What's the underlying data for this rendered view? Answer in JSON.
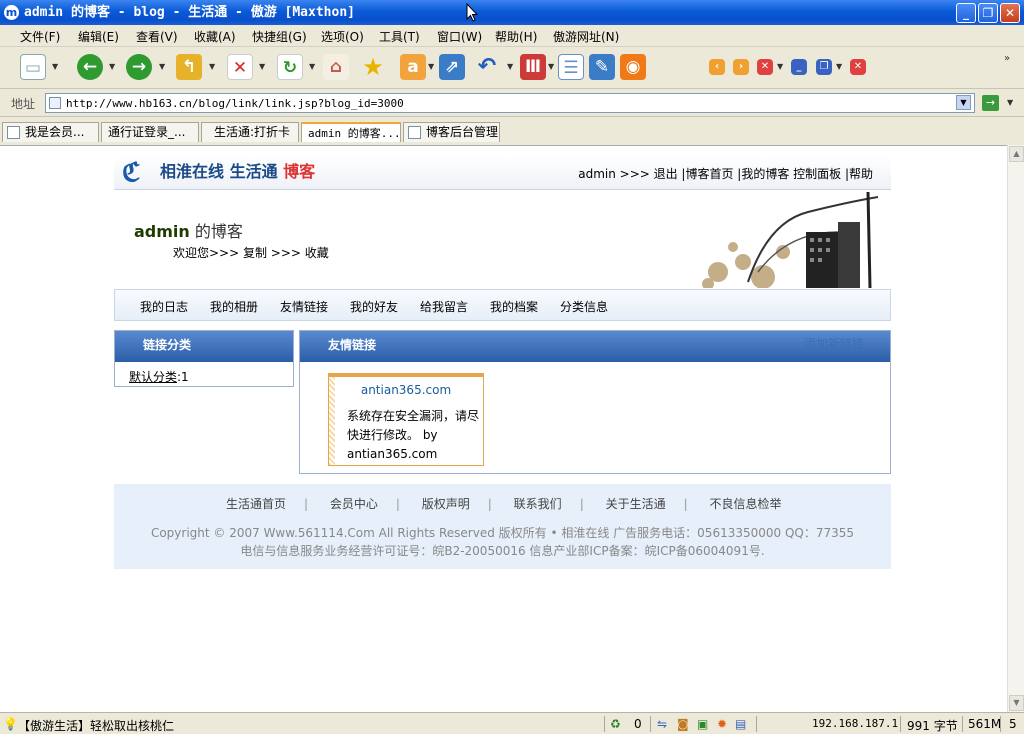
{
  "window": {
    "title": "admin 的博客 - blog - 生活通 - 傲游 [Maxthon]",
    "minimize": "_",
    "restore": "❐",
    "close": "✕"
  },
  "menu": [
    "文件(F)",
    "编辑(E)",
    "查看(V)",
    "收藏(A)",
    "快捷组(G)",
    "选项(O)",
    "工具(T)",
    "窗口(W)",
    "帮助(H)",
    "傲游网址(N)"
  ],
  "address": {
    "label": "地址",
    "url": "http://www.hb163.cn/blog/link/link.jsp?blog_id=3000"
  },
  "tabs": [
    "我是会员...",
    "通行证登录_...",
    "生活通:打折卡",
    "admin 的博客...",
    "博客后台管理"
  ],
  "page": {
    "logo": {
      "mark": "ℭ",
      "text": "相淮在线 生活通",
      "accent": "博客"
    },
    "top_links": "admin >>> 退出 |博客首页 |我的博客 控制面板 |帮助",
    "blog_title_user": "admin",
    "blog_title_rest": " 的博客",
    "welcome": "欢迎您>>> 复制 >>> 收藏",
    "nav": [
      "我的日志",
      "我的相册",
      "友情链接",
      "我的好友",
      "给我留言",
      "我的档案",
      "分类信息"
    ],
    "left_panel": {
      "heading": "链接分类",
      "category": "默认分类",
      "count": ":1"
    },
    "right_panel": {
      "heading": "友情链接",
      "add_link": "添加新链接"
    },
    "card": {
      "title": "antian365.com",
      "body": "系统存在安全漏洞，请尽快进行修改。 by antian365.com"
    },
    "footer": {
      "links": [
        "生活通首页",
        "会员中心",
        "版权声明",
        "联系我们",
        "关于生活通",
        "不良信息检举"
      ],
      "copyright": "Copyright © 2007 Www.561114.Com All Rights Reserved 版权所有 • 相淮在线 广告服务电话：05613350000 QQ：77355",
      "license": "电信与信息服务业务经营许可证号：皖B2-20050016 信息产业部ICP备案：皖ICP备06004091号."
    }
  },
  "status": {
    "message": "【傲游生活】轻松取出核桃仁",
    "count": "0",
    "ip": "192.168.187.1",
    "bytes": "991 字节",
    "memory": "561M",
    "page": "5"
  }
}
